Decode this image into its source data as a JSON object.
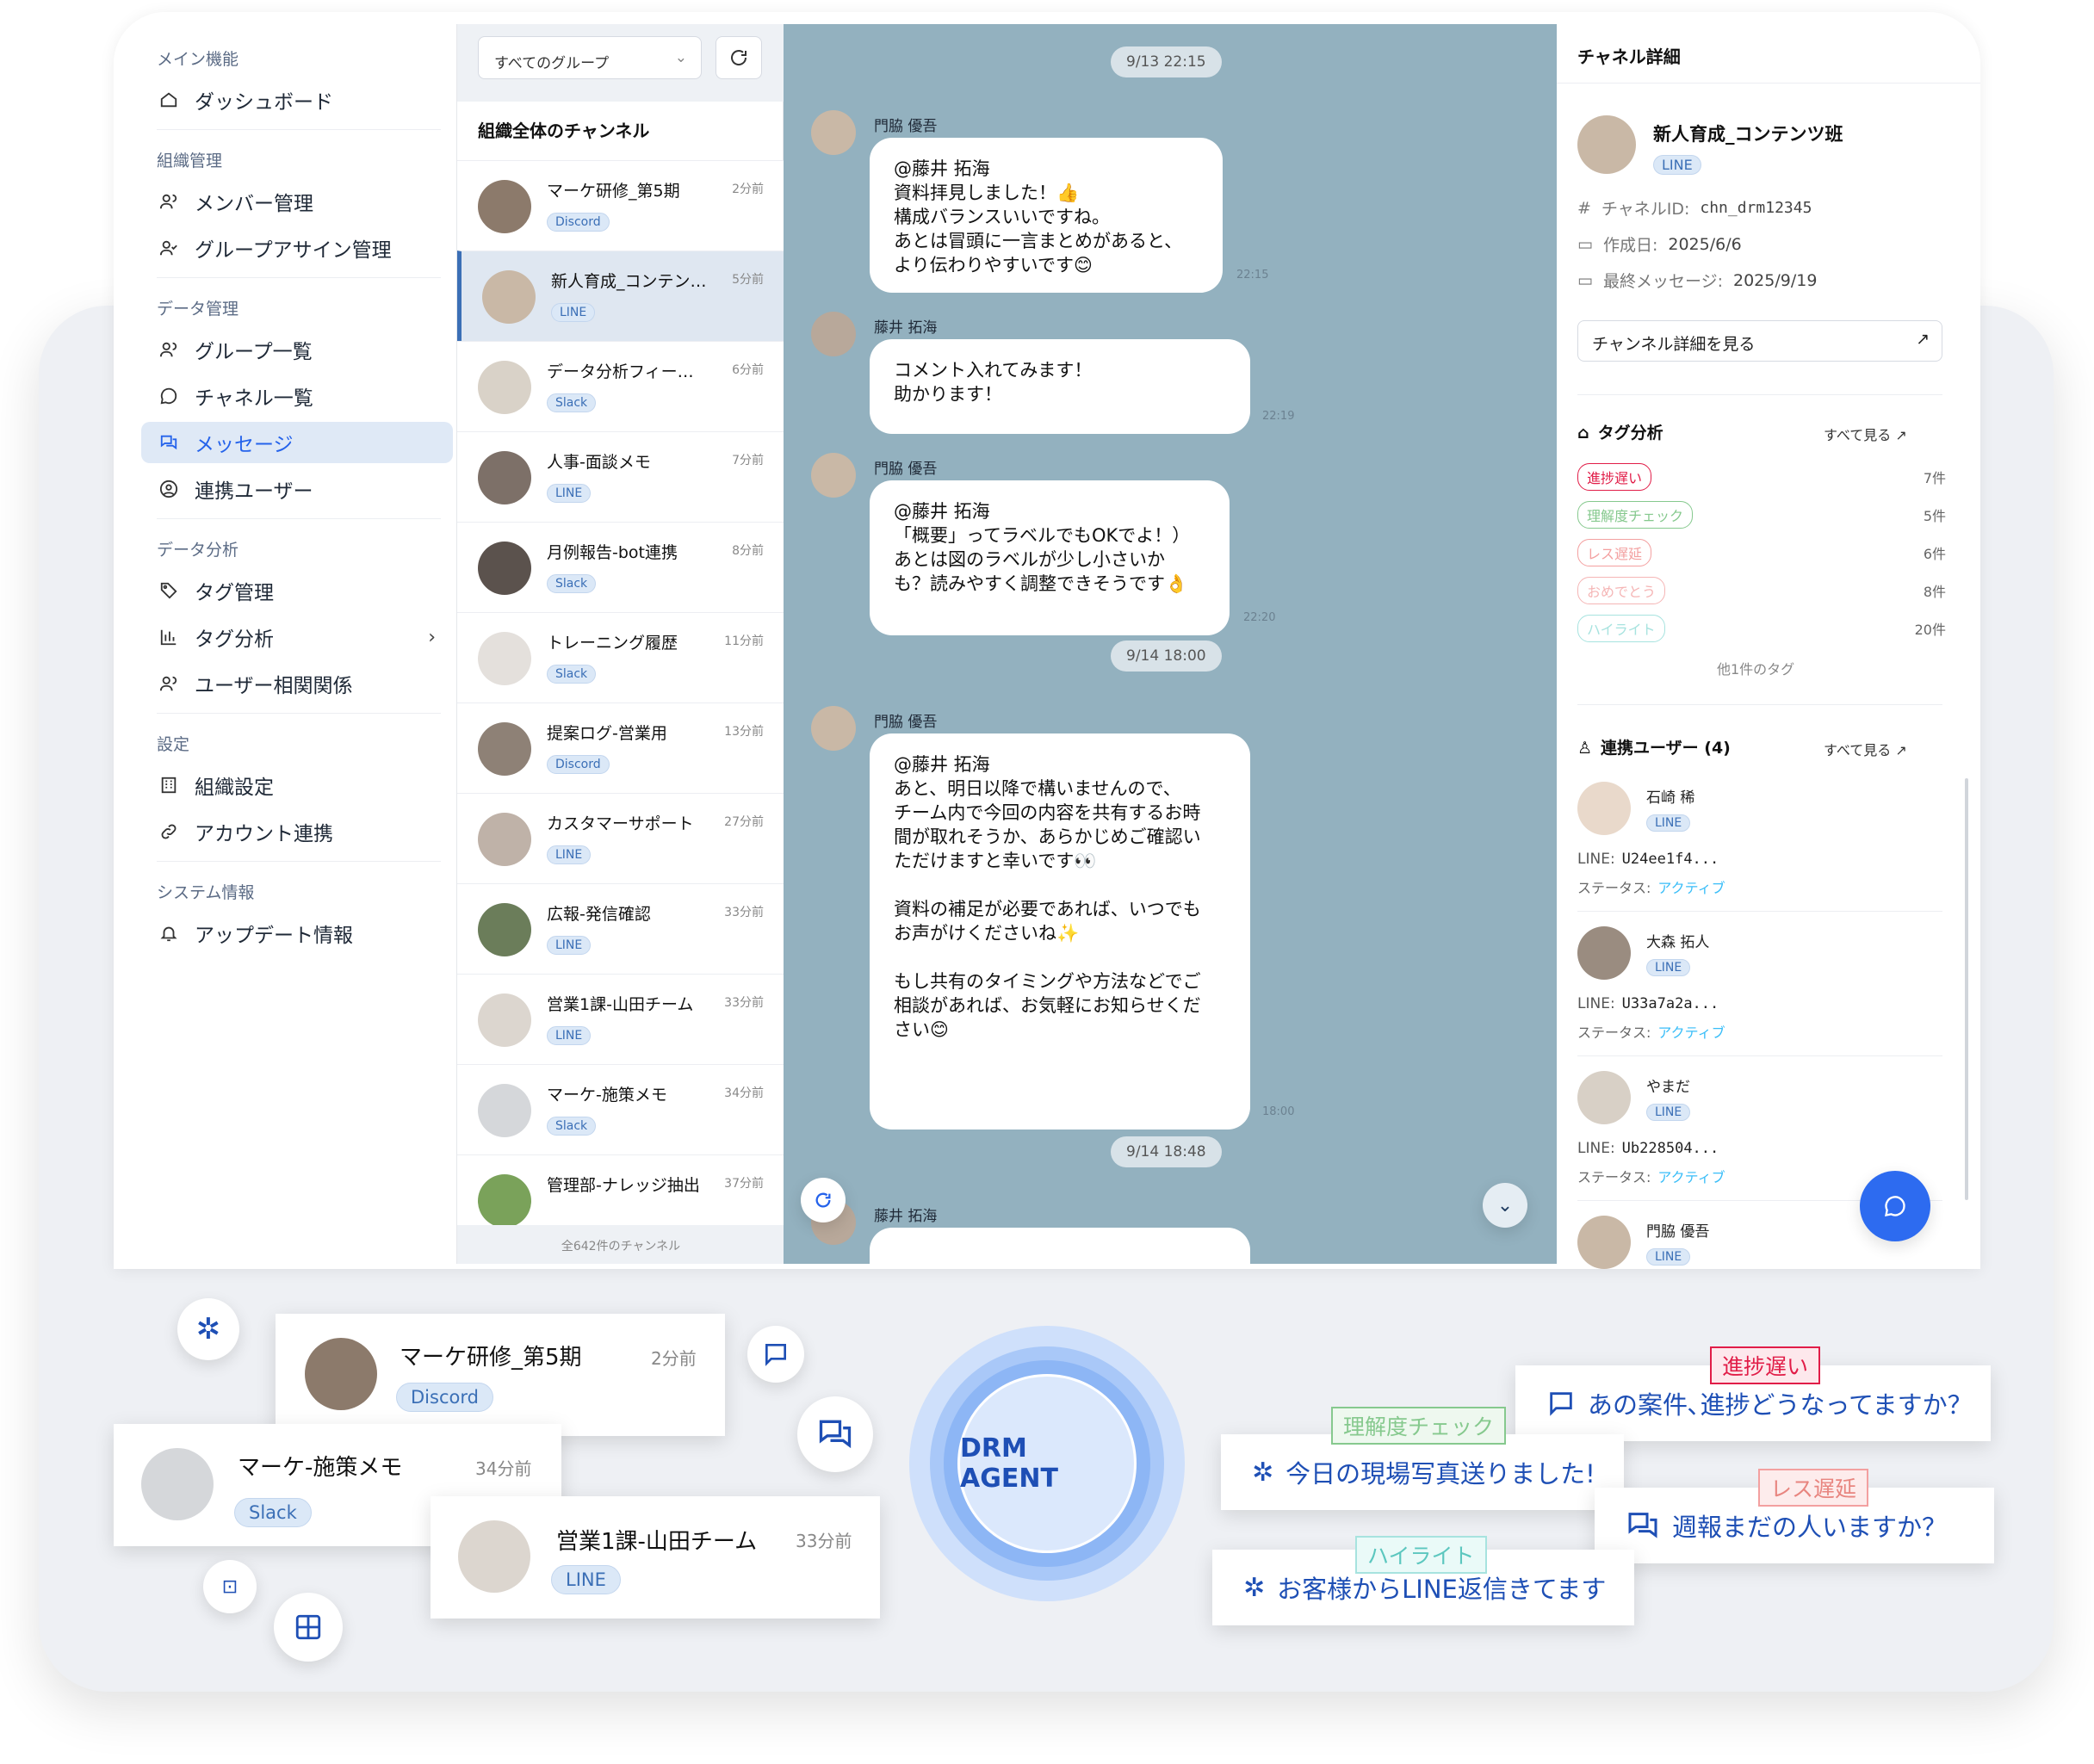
{
  "sidebar": {
    "sections": [
      {
        "title": "メイン機能",
        "items": [
          "ダッシュボード"
        ]
      },
      {
        "title": "組織管理",
        "items": [
          "メンバー管理",
          "グループアサイン管理"
        ]
      },
      {
        "title": "データ管理",
        "items": [
          "グループ一覧",
          "チャネル一覧",
          "メッセージ",
          "連携ユーザー"
        ]
      },
      {
        "title": "データ分析",
        "items": [
          "タグ管理",
          "タグ分析",
          "ユーザー相関関係"
        ]
      },
      {
        "title": "設定",
        "items": [
          "組織設定",
          "アカウント連携"
        ]
      },
      {
        "title": "システム情報",
        "items": [
          "アップデート情報"
        ]
      }
    ],
    "active_item": "メッセージ"
  },
  "channel_list": {
    "group_select": "すべてのグループ",
    "heading": "組織全体のチャンネル",
    "channels": [
      {
        "name": "マーケ研修_第5期",
        "time": "2分前",
        "platform": "Discord"
      },
      {
        "name": "新人育成_コンテン…",
        "time": "5分前",
        "platform": "LINE"
      },
      {
        "name": "データ分析フィー…",
        "time": "6分前",
        "platform": "Slack"
      },
      {
        "name": "人事-面談メモ",
        "time": "7分前",
        "platform": "LINE"
      },
      {
        "name": "月例報告-bot連携",
        "time": "8分前",
        "platform": "Slack"
      },
      {
        "name": "トレーニング履歴",
        "time": "11分前",
        "platform": "Slack"
      },
      {
        "name": "提案ログ-営業用",
        "time": "13分前",
        "platform": "Discord"
      },
      {
        "name": "カスタマーサポート",
        "time": "27分前",
        "platform": "LINE"
      },
      {
        "name": "広報-発信確認",
        "time": "33分前",
        "platform": "LINE"
      },
      {
        "name": "営業1課-山田チーム",
        "time": "33分前",
        "platform": "LINE"
      },
      {
        "name": "マーケ-施策メモ",
        "time": "34分前",
        "platform": "Slack"
      },
      {
        "name": "管理部-ナレッジ抽出",
        "time": "37分前",
        "platform": ""
      }
    ],
    "footer": "全642件のチャンネル"
  },
  "chat": {
    "dates": [
      "9/13 22:15",
      "9/14 18:00",
      "9/14 18:48"
    ],
    "messages": [
      {
        "sender": "門脇 優吾",
        "text": "@藤井 拓海\n資料拝見しました！👍\n構成バランスいいですね。\nあとは冒頭に一言まとめがあると、\nより伝わりやすいです😊",
        "time": "22:15"
      },
      {
        "sender": "藤井 拓海",
        "text": "コメント入れてみます！\n助かります！",
        "time": "22:19"
      },
      {
        "sender": "門脇 優吾",
        "text": "@藤井 拓海\n「概要」ってラベルでもOKでよ！）\nあとは図のラベルが少し小さいか\nも？読みやすく調整できそうです👌",
        "time": "22:20"
      },
      {
        "sender": "門脇 優吾",
        "text": "@藤井 拓海\nあと、明日以降で構いませんので、\nチーム内で今回の内容を共有するお時\n間が取れそうか、あらかじめご確認い\nただけますと幸いです👀\n\n資料の補足が必要であれば、いつでも\nお声がけくださいね✨\n\nもし共有のタイミングや方法などでご\n相談があれば、お気軽にお知らせくだ\nさい😊",
        "time": "18:00"
      },
      {
        "sender": "藤井 拓海",
        "text": "",
        "time": ""
      }
    ]
  },
  "detail": {
    "heading": "チャネル詳細",
    "channel_name": "新人育成_コンテンツ班",
    "platform": "LINE",
    "channel_id_label": "チャネルID:",
    "channel_id": "chn_drm12345",
    "created_label": "作成日:",
    "created": "2025/6/6",
    "last_msg_label": "最終メッセージ:",
    "last_msg": "2025/9/19",
    "view_button": "チャンネル詳細を見る",
    "tag_heading": "タグ分析",
    "see_all": "すべて見る",
    "tags": [
      {
        "name": "進捗遅い",
        "count": "7件",
        "color": "#e11d48"
      },
      {
        "name": "理解度チェック",
        "count": "5件",
        "color": "#86c98e"
      },
      {
        "name": "レス遅延",
        "count": "6件",
        "color": "#f3a0a0"
      },
      {
        "name": "おめでとう",
        "count": "8件",
        "color": "#f5b5b5"
      },
      {
        "name": "ハイライト",
        "count": "20件",
        "color": "#a7e3df"
      }
    ],
    "other_tags": "他1件のタグ",
    "users_heading": "連携ユーザー (4)",
    "line_label": "LINE:",
    "status_label": "ステータス:",
    "users": [
      {
        "name": "石崎 稀",
        "platform": "LINE",
        "line_id": "U24ee1f4...",
        "status": "アクティブ"
      },
      {
        "name": "大森 拓人",
        "platform": "LINE",
        "line_id": "U33a7a2a...",
        "status": "アクティブ"
      },
      {
        "name": "やまだ",
        "platform": "LINE",
        "line_id": "Ub228504...",
        "status": "アクティブ"
      },
      {
        "name": "門脇 優吾",
        "platform": "LINE",
        "line_id": "",
        "status": ""
      }
    ]
  },
  "floating": {
    "cards": [
      {
        "name": "マーケ研修_第5期",
        "time": "2分前",
        "platform": "Discord"
      },
      {
        "name": "マーケ-施策メモ",
        "time": "34分前",
        "platform": "Slack"
      },
      {
        "name": "営業1課-山田チーム",
        "time": "33分前",
        "platform": "LINE"
      }
    ],
    "agent_label": "DRM AGENT",
    "pills": [
      {
        "tag": "進捗遅い",
        "text": "あの案件､進捗どうなってますか？"
      },
      {
        "tag": "理解度チェック",
        "text": "今日の現場写真送りました!"
      },
      {
        "tag": "レス遅延",
        "text": "週報まだの人いますか？"
      },
      {
        "tag": "ハイライト",
        "text": "お客様からLINE返信きてます"
      }
    ]
  },
  "colors": {
    "accent": "#2563eb",
    "chat_bg": "#93b1bf",
    "active_nav": "#dfe9f6"
  }
}
